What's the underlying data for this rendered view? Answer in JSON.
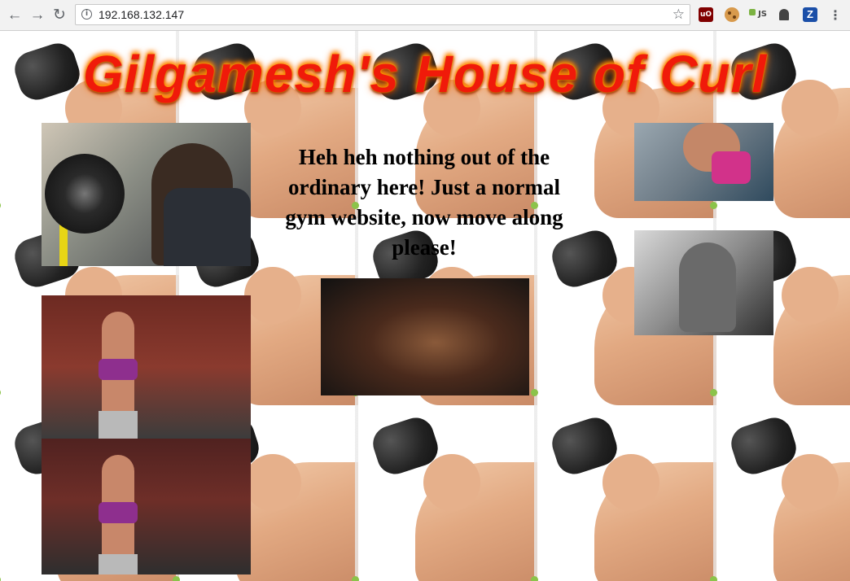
{
  "browser": {
    "url": "192.168.132.147",
    "extensions": [
      {
        "name": "ublock-icon",
        "label": "uO"
      },
      {
        "name": "cookie-icon",
        "label": ""
      },
      {
        "name": "js-icon",
        "label": "JS"
      },
      {
        "name": "ghostery-icon",
        "label": ""
      },
      {
        "name": "z-icon",
        "label": "Z"
      }
    ]
  },
  "page": {
    "title": "Gilgamesh's House of Curl",
    "tagline": "Heh heh nothing out of the ordinary here! Just a normal gym website, now move along please!",
    "colors": {
      "title": "#f01a0a",
      "tagline": "#000000",
      "background": "#ffffff"
    }
  },
  "photos": [
    {
      "name": "photo-man-curling-dumbbell",
      "alt": ""
    },
    {
      "name": "photo-woman-cable-raise",
      "alt": ""
    },
    {
      "name": "photo-woman-flexing",
      "alt": ""
    },
    {
      "name": "photo-bodybuilder-cable",
      "alt": ""
    },
    {
      "name": "photo-woman-preacher-curl",
      "alt": ""
    },
    {
      "name": "photo-bodybuilder-barbell-curl",
      "alt": ""
    }
  ]
}
